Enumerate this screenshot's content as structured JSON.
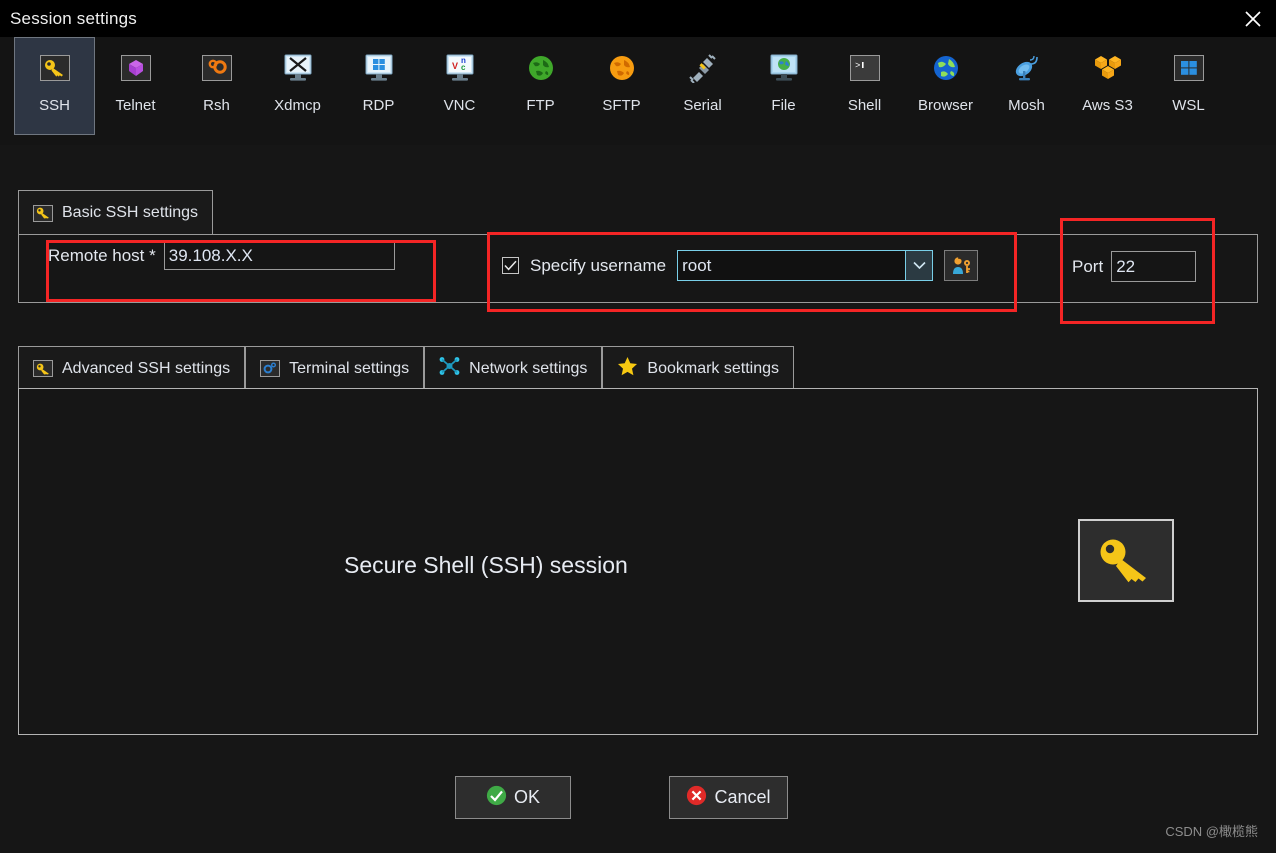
{
  "window": {
    "title": "Session settings",
    "close_icon": "close-icon"
  },
  "protocols": [
    {
      "label": "SSH",
      "icon": "key-icon",
      "selected": true
    },
    {
      "label": "Telnet",
      "icon": "purple-cube-icon",
      "selected": false
    },
    {
      "label": "Rsh",
      "icon": "orange-gears-icon",
      "selected": false
    },
    {
      "label": "Xdmcp",
      "icon": "x-monitor-icon",
      "selected": false
    },
    {
      "label": "RDP",
      "icon": "windows-monitor-icon",
      "selected": false
    },
    {
      "label": "VNC",
      "icon": "vnc-monitor-icon",
      "selected": false
    },
    {
      "label": "FTP",
      "icon": "green-globe-icon",
      "selected": false
    },
    {
      "label": "SFTP",
      "icon": "orange-globe-icon",
      "selected": false
    },
    {
      "label": "Serial",
      "icon": "serial-plug-icon",
      "selected": false
    },
    {
      "label": "File",
      "icon": "file-monitor-icon",
      "selected": false
    },
    {
      "label": "Shell",
      "icon": "terminal-prompt-icon",
      "selected": false
    },
    {
      "label": "Browser",
      "icon": "blue-globe-icon",
      "selected": false
    },
    {
      "label": "Mosh",
      "icon": "satellite-dish-icon",
      "selected": false
    },
    {
      "label": "Aws S3",
      "icon": "aws-cubes-icon",
      "selected": false
    },
    {
      "label": "WSL",
      "icon": "windows-logo-icon",
      "selected": false
    }
  ],
  "basic_tab": {
    "label": "Basic SSH settings",
    "icon": "key-icon"
  },
  "basic_form": {
    "remote_host": {
      "label": "Remote host *",
      "value": "39.108.X.X",
      "placeholder": ""
    },
    "specify_username": {
      "label": "Specify username",
      "checked": true,
      "check_glyph": "✓",
      "value": "root",
      "placeholder": "",
      "dropdown_icon": "chevron-down-icon",
      "browse_icon": "user-key-icon"
    },
    "port": {
      "label": "Port",
      "value": "22",
      "up_icon": "spinner-up-icon",
      "down_icon": "spinner-down-icon"
    }
  },
  "annotations": {
    "color": "#f42525",
    "boxes": [
      "remote-host",
      "specify-username",
      "port"
    ]
  },
  "secondary_tabs": [
    {
      "label": "Advanced SSH settings",
      "icon": "key-icon",
      "selected": false
    },
    {
      "label": "Terminal settings",
      "icon": "terminal-gear-icon",
      "selected": false
    },
    {
      "label": "Network settings",
      "icon": "network-node-icon",
      "selected": false
    },
    {
      "label": "Bookmark settings",
      "icon": "star-icon",
      "selected": false
    }
  ],
  "content": {
    "caption": "Secure Shell (SSH) session",
    "big_icon": "key-icon"
  },
  "footer": {
    "ok": {
      "label": "OK",
      "icon": "green-check-icon"
    },
    "cancel": {
      "label": "Cancel",
      "icon": "red-x-icon"
    }
  },
  "watermark": "CSDN @橄榄熊",
  "colors": {
    "window_bg": "#161616",
    "titlebar_bg": "#000000",
    "selected_tab_bg": "#2e3644",
    "border": "#9a9a9a",
    "text": "#e3e7ee",
    "focus_border": "#79cfe8",
    "annotation_red": "#f42525",
    "key_yellow": "#f5c518",
    "ok_green": "#3faa46",
    "cancel_red": "#e02a28"
  }
}
